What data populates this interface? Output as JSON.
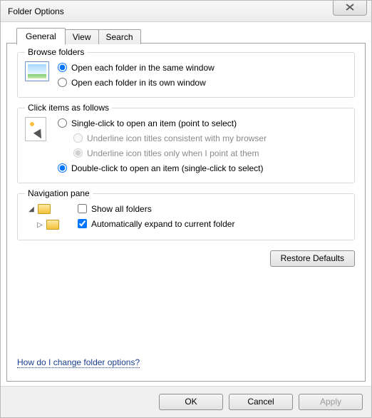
{
  "title": "Folder Options",
  "tabs": {
    "general": "General",
    "view": "View",
    "search": "Search"
  },
  "browse": {
    "legend": "Browse folders",
    "same": "Open each folder in the same window",
    "own": "Open each folder in its own window"
  },
  "click": {
    "legend": "Click items as follows",
    "single": "Single-click to open an item (point to select)",
    "u_browser": "Underline icon titles consistent with my browser",
    "u_point": "Underline icon titles only when I point at them",
    "double": "Double-click to open an item (single-click to select)"
  },
  "nav": {
    "legend": "Navigation pane",
    "show_all": "Show all folders",
    "auto_expand": "Automatically expand to current folder"
  },
  "restore": "Restore Defaults",
  "help": "How do I change folder options?",
  "buttons": {
    "ok": "OK",
    "cancel": "Cancel",
    "apply": "Apply"
  }
}
